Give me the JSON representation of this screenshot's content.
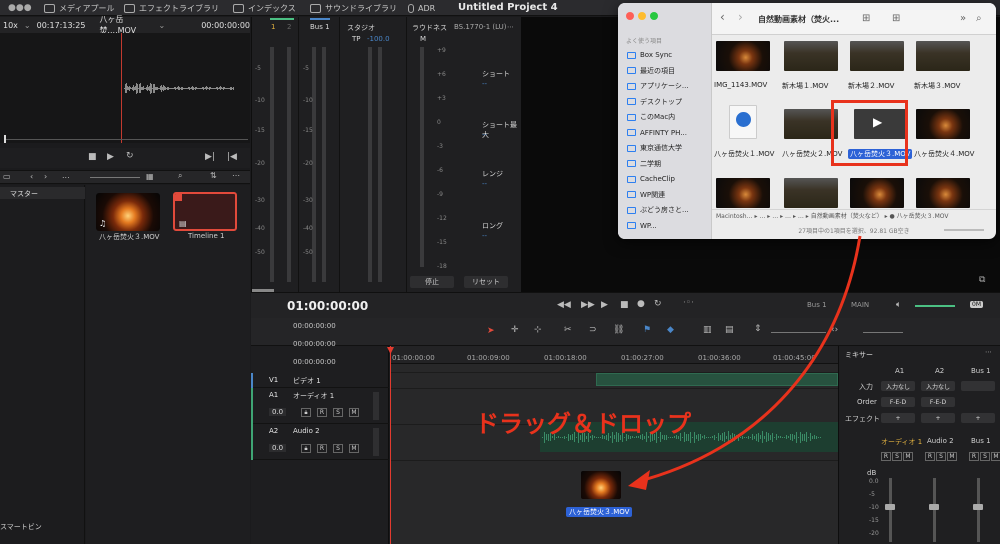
{
  "topbar": {
    "tabs": [
      "メディアプール",
      "エフェクトライブラリ",
      "インデックス",
      "サウンドライブラリ",
      "ADR"
    ],
    "project_title": "Untitled Project 4"
  },
  "source_viewer": {
    "zoom": "10x",
    "duration": "00:17:13:25",
    "clip_name": "八ヶ岳焚....MOV",
    "timecode": "00:00:00:00"
  },
  "media_pool": {
    "master_label": "マスター",
    "smart_bin_label": "スマートビン",
    "items": [
      {
        "label": "八ヶ岳焚火３.MOV"
      },
      {
        "label": "Timeline 1"
      }
    ],
    "search_placeholder": "..."
  },
  "meters": {
    "ch1": "1",
    "ch2": "2",
    "bus1": "Bus 1",
    "studio": "スタジオ",
    "tp_label": "TP",
    "tp_value": "-100.0",
    "m_label": "M",
    "loudness": "ラウドネス",
    "loudness_std": "BS.1770-1 (LU)",
    "scale_db": [
      "-5",
      "-10",
      "-15",
      "-20",
      "-30",
      "-40",
      "-50"
    ],
    "scale_lu": [
      "+9",
      "+6",
      "+3",
      "0",
      "-3",
      "-6",
      "-9",
      "-12",
      "-15",
      "-18"
    ],
    "short_label": "ショート",
    "short_max_label": "ショート最大",
    "range_label": "レンジ",
    "long_label": "ロング",
    "value_dash": "--",
    "stop_btn": "停止",
    "reset_btn": "リセット"
  },
  "timeline": {
    "timecode": "01:00:00:00",
    "bus_label": "Bus 1",
    "main_label": "MAIN",
    "om_label": "0M",
    "head_times": [
      "00:00:00:00",
      "00:00:00:00",
      "00:00:00:00"
    ],
    "ruler": [
      "01:00:00:00",
      "01:00:09:00",
      "01:00:18:00",
      "01:00:27:00",
      "01:00:36:00",
      "01:00:45:00"
    ],
    "tracks": [
      {
        "id": "V1",
        "name": "ビデオ 1"
      },
      {
        "id": "A1",
        "name": "オーディオ 1",
        "level": "0.0"
      },
      {
        "id": "A2",
        "name": "Audio 2",
        "level": "0.0"
      }
    ]
  },
  "mixer": {
    "title": "ミキサー",
    "cols": [
      "A1",
      "A2",
      "Bus 1"
    ],
    "input_label": "入力",
    "input_value": "入力なし",
    "order_label": "Order",
    "order_value": "F-E-D",
    "effect_label": "エフェクト",
    "plus": "+",
    "channel_names": [
      "オーディオ 1",
      "Audio 2",
      "Bus 1"
    ],
    "db_label": "dB",
    "db_scale": [
      "0.0",
      "-5",
      "-10",
      "-15",
      "-20"
    ],
    "rsm": [
      "R",
      "S",
      "M"
    ]
  },
  "finder": {
    "title": "自然動画素材（焚火...",
    "section_label": "よく使う項目",
    "sidebar": [
      "Box Sync",
      "最近の項目",
      "アプリケーシ...",
      "デスクトップ",
      "このMac内",
      "AFFINTY PH...",
      "東京通信大学",
      "二学期",
      "CacheClip",
      "WP関連",
      "ぶどう房さと...",
      "WP..."
    ],
    "files": [
      {
        "label": "IMG_1143.MOV"
      },
      {
        "label": "新木場１.MOV"
      },
      {
        "label": "新木場２.MOV"
      },
      {
        "label": "新木場３.MOV"
      },
      {
        "label": "八ヶ岳焚火１.MOV"
      },
      {
        "label": "八ヶ岳焚火２.MOV"
      },
      {
        "label": "八ヶ岳焚火３.MOV"
      },
      {
        "label": "八ヶ岳焚火４.MOV"
      }
    ],
    "path": "Macintosh… ▸ … ▸ … ▸ … ▸ … ▸ 自然動画素材（焚火など） ▸ ● 八ヶ岳焚火３.MOV",
    "status": "27項目中の1項目を選択、92.81 GB空き"
  },
  "overlay": {
    "drag_text": "ドラッグ＆ドロップ",
    "drag_label": "八ヶ岳焚火３.MOV",
    "accent": "#e8321c"
  }
}
